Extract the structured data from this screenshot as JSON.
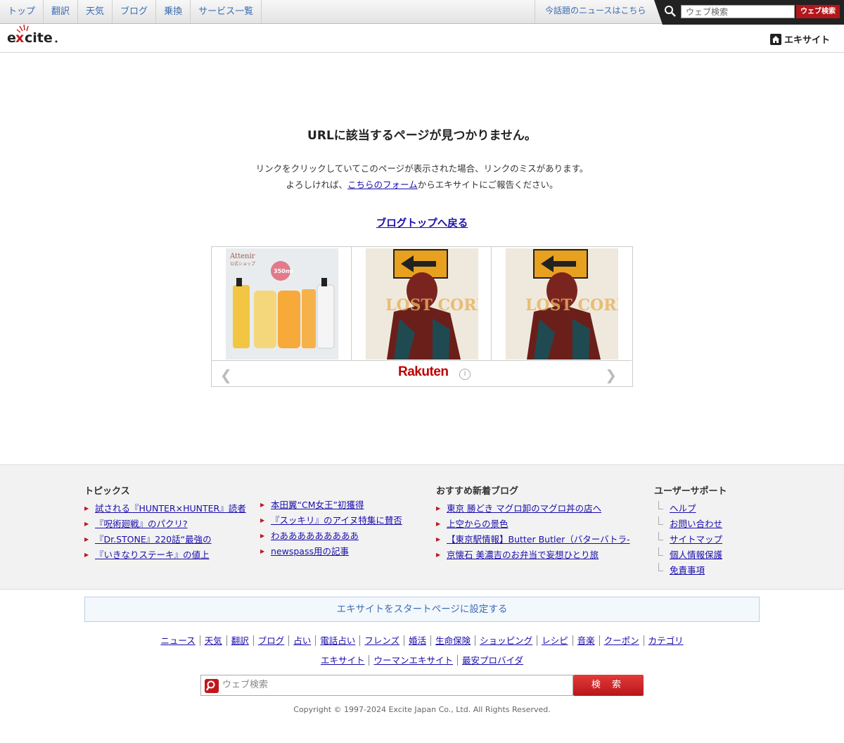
{
  "topnav": {
    "items": [
      "トップ",
      "翻訳",
      "天気",
      "ブログ",
      "乗換",
      "サービス一覧"
    ],
    "news_link": "今話題のニュースはこちら",
    "search_placeholder": "ウェブ検索",
    "search_button": "ウェブ検索"
  },
  "header": {
    "logo_text": "excite.",
    "home_link": "エキサイト"
  },
  "error": {
    "title": "URLに該当するページが見つかりません。",
    "line1": "リンクをクリックしていてこのページが表示された場合、リンクのミスがあります。",
    "line2_pre": "よろしければ、",
    "line2_link": "こちらのフォーム",
    "line2_post": "からエキサイトにご報告ください。",
    "back_link": "ブログトップへ戻る"
  },
  "ad": {
    "brand": "Rakuten",
    "items": [
      {
        "label": "Attenir",
        "sub": "公式ショップ",
        "badge": "350ml"
      },
      {
        "label": "LOST CORNER"
      },
      {
        "label": "LOST CORNER"
      }
    ]
  },
  "footer": {
    "topics": {
      "title": "トピックス",
      "col1": [
        "試される『HUNTER×HUNTER』読者",
        "『呪術廻戦』のパクリ?",
        "『Dr.STONE』220話“最強の",
        "『いきなりステーキ』の値上"
      ],
      "col2": [
        "本田翼“CM女王”初獲得",
        "『スッキリ』のアイヌ特集に賛否",
        "わあああああああああ",
        "newspass用の記事"
      ]
    },
    "blogs": {
      "title": "おすすめ新着ブログ",
      "items": [
        "東京 勝どき マグロ卸のマグロ丼の店へ",
        "上空からの景色",
        "【東京駅情報】Butter Butler（バターバトラ-",
        "京懐石 美濃吉のお弁当で妄想ひとり旅"
      ]
    },
    "support": {
      "title": "ユーザーサポート",
      "items": [
        "ヘルプ",
        "お問い合わせ",
        "サイトマップ",
        "個人情報保護",
        "免責事項"
      ]
    }
  },
  "startpage": "エキサイトをスタートページに設定する",
  "bottomnav": {
    "row1": [
      "ニュース",
      "天気",
      "翻訳",
      "ブログ",
      "占い",
      "電話占い",
      "フレンズ",
      "婚活",
      "生命保険",
      "ショッピング",
      "レシピ",
      "音楽",
      "クーポン",
      "カテゴリ"
    ],
    "row2": [
      "エキサイト",
      "ウーマンエキサイト",
      "最安プロバイダ"
    ]
  },
  "bottom_search": {
    "placeholder": "ウェブ検索",
    "button": "検 索"
  },
  "copyright": "Copyright © 1997-2024 Excite Japan Co., Ltd. All Rights Reserved."
}
